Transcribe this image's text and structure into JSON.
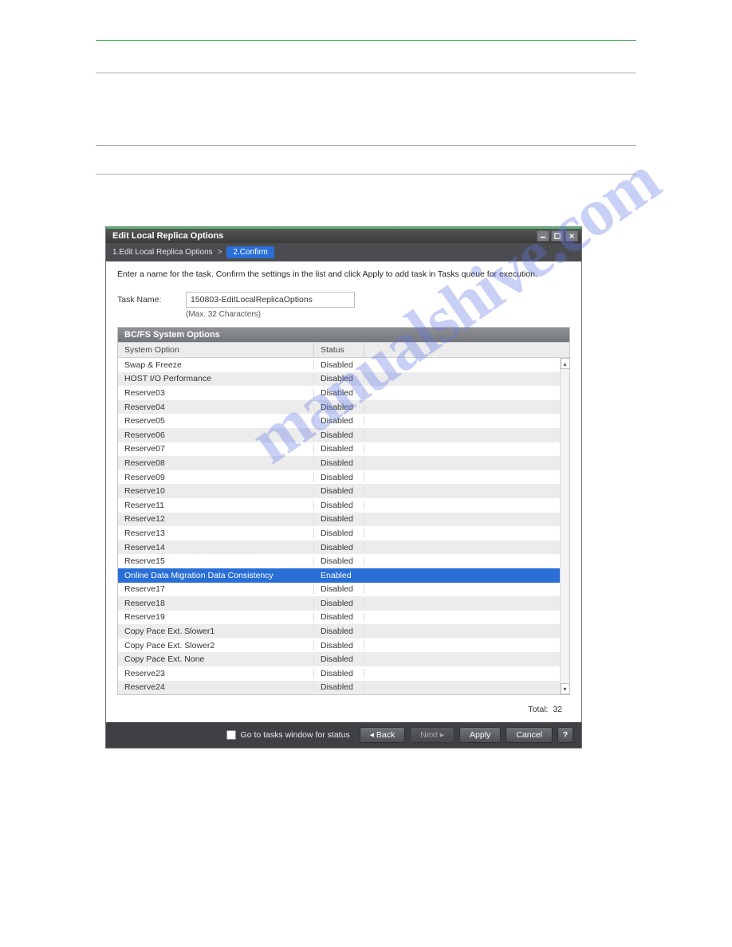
{
  "watermark": "manualshive.com",
  "window": {
    "title": "Edit Local Replica Options",
    "breadcrumb_step1": "1.Edit Local Replica Options",
    "breadcrumb_sep": ">",
    "breadcrumb_step2": "2.Confirm"
  },
  "instruction": "Enter a name for the task. Confirm the settings in the list and click Apply to add task in Tasks queue for execution.",
  "task_name": {
    "label": "Task Name:",
    "value": "150803-EditLocalReplicaOptions",
    "hint": "(Max. 32 Characters)"
  },
  "table": {
    "title": "BC/FS System Options",
    "col1": "System Option",
    "col2": "Status",
    "rows": [
      {
        "option": "Swap & Freeze",
        "status": "Disabled",
        "selected": false
      },
      {
        "option": "HOST I/O Performance",
        "status": "Disabled",
        "selected": false
      },
      {
        "option": "Reserve03",
        "status": "Disabled",
        "selected": false
      },
      {
        "option": "Reserve04",
        "status": "Disabled",
        "selected": false
      },
      {
        "option": "Reserve05",
        "status": "Disabled",
        "selected": false
      },
      {
        "option": "Reserve06",
        "status": "Disabled",
        "selected": false
      },
      {
        "option": "Reserve07",
        "status": "Disabled",
        "selected": false
      },
      {
        "option": "Reserve08",
        "status": "Disabled",
        "selected": false
      },
      {
        "option": "Reserve09",
        "status": "Disabled",
        "selected": false
      },
      {
        "option": "Reserve10",
        "status": "Disabled",
        "selected": false
      },
      {
        "option": "Reserve11",
        "status": "Disabled",
        "selected": false
      },
      {
        "option": "Reserve12",
        "status": "Disabled",
        "selected": false
      },
      {
        "option": "Reserve13",
        "status": "Disabled",
        "selected": false
      },
      {
        "option": "Reserve14",
        "status": "Disabled",
        "selected": false
      },
      {
        "option": "Reserve15",
        "status": "Disabled",
        "selected": false
      },
      {
        "option": "Online Data Migration Data Consistency",
        "status": "Enabled",
        "selected": true
      },
      {
        "option": "Reserve17",
        "status": "Disabled",
        "selected": false
      },
      {
        "option": "Reserve18",
        "status": "Disabled",
        "selected": false
      },
      {
        "option": "Reserve19",
        "status": "Disabled",
        "selected": false
      },
      {
        "option": "Copy Pace Ext. Slower1",
        "status": "Disabled",
        "selected": false
      },
      {
        "option": "Copy Pace Ext. Slower2",
        "status": "Disabled",
        "selected": false
      },
      {
        "option": "Copy Pace Ext. None",
        "status": "Disabled",
        "selected": false
      },
      {
        "option": "Reserve23",
        "status": "Disabled",
        "selected": false
      },
      {
        "option": "Reserve24",
        "status": "Disabled",
        "selected": false
      }
    ],
    "total_label": "Total:",
    "total_value": "32"
  },
  "footer": {
    "checkbox_label": "Go to tasks window for status",
    "back": "Back",
    "next": "Next",
    "apply": "Apply",
    "cancel": "Cancel",
    "help": "?"
  }
}
